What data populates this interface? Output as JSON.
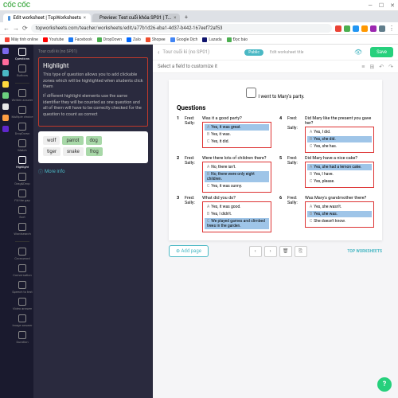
{
  "window": {
    "logo": "CỐC CỐC",
    "min": "—",
    "max": "☐",
    "close": "✕"
  },
  "tabs": [
    {
      "label": "Edit worksheet | TopWorksheets",
      "active": true
    },
    {
      "label": "Preview: Test cuối khóa SP01 | T...",
      "active": false
    }
  ],
  "url": "topworksheets.com/teacher/worksheets/edit/a77b1d26-eba1-4d37-b442-167eef72af53",
  "bookmarks": [
    "Máy tính online",
    "Youtube",
    "Facebook",
    "DropDown",
    "Zalo",
    "Shopee",
    "Google Dịch",
    "Lazada",
    "Đọc báo"
  ],
  "rail2": [
    {
      "label": "Questions",
      "active": true
    },
    {
      "label": "Buttons"
    },
    {
      "label": "Written answer"
    },
    {
      "label": "Multiple choice"
    },
    {
      "label": "DropDown"
    },
    {
      "label": "Match"
    },
    {
      "label": "Highlight",
      "active": true
    },
    {
      "label": "Drag&Drop"
    },
    {
      "label": "Fill the gap"
    },
    {
      "label": "Sort"
    },
    {
      "label": "Wordsearch"
    },
    {
      "label": "Crossword"
    },
    {
      "label": "Conversation"
    },
    {
      "label": "Speech to text"
    },
    {
      "label": "Video answer"
    },
    {
      "label": "Image answer"
    },
    {
      "label": "Duration"
    }
  ],
  "panel": {
    "breadcrumb": "Tour cuối kì (no SP01)",
    "title": "Highlight",
    "desc1": "This type of question allows you to add clickable zones which will be highlighted when students click them",
    "desc2": "If different highlight elements use the same identifier they will be counted as one question and all of them will have to be correctly checked for the question to count as correct",
    "words": [
      [
        "wolf",
        "parrot",
        "dog"
      ],
      [
        "tiger",
        "snake",
        "frog"
      ]
    ],
    "more": "More info"
  },
  "topbar": {
    "title": "Tour cuối kì (no SP01)",
    "public": "Public",
    "edit": "Edit worksheet title",
    "save": "Save"
  },
  "subbar": {
    "prompt": "Select a field to customize it"
  },
  "sheet": {
    "want": "I went to Mary's party.",
    "title": "Questions",
    "qs": [
      {
        "n": "1",
        "who": "Fred:",
        "q": "Was it a good party?",
        "a": {
          "who": "Sally:",
          "sel": "Yes, it was great.",
          "opts": [
            "Yes, it was great.",
            "Yes, it was.",
            "Yes, it did."
          ]
        }
      },
      {
        "n": "4",
        "who": "Fred:",
        "q": "Did Mary like the present you gave her?",
        "a": {
          "who": "Sally:",
          "sel": "Yes, she did.",
          "opts": [
            "Yes, I did.",
            "Yes, she did.",
            "Yes, she has."
          ]
        }
      },
      {
        "n": "2",
        "who": "Fred:",
        "q": "Were there lots of children there?",
        "a": {
          "who": "Sally:",
          "sel": "No, there were only eight children.",
          "opts": [
            "No, there isn't.",
            "No, there were only eight children.",
            "Yes, it was sunny."
          ]
        }
      },
      {
        "n": "5",
        "who": "Fred:",
        "q": "Did Mary have a nice cake?",
        "a": {
          "who": "Sally:",
          "sel": "Yes, she had a lemon cake.",
          "opts": [
            "Yes, she had a lemon cake.",
            "Yes, I have.",
            "Yes, please."
          ]
        }
      },
      {
        "n": "3",
        "who": "Fred:",
        "q": "What did you do?",
        "a": {
          "who": "Sally:",
          "sel": "We played games and climbed trees in the garden.",
          "opts": [
            "Yes, it was good.",
            "Yes, I didn't.",
            "We played games and climbed trees in the garden."
          ]
        }
      },
      {
        "n": "6",
        "who": "Fred:",
        "q": "Was Mary's grandmother there?",
        "a": {
          "who": "Sally:",
          "sel": "Yes, she was.",
          "opts": [
            "Yes, she wasn't.",
            "Yes, she was.",
            "She doesn't know."
          ]
        }
      }
    ],
    "addpage": "Add page",
    "watermark": "TOP WORKSHEETS"
  }
}
